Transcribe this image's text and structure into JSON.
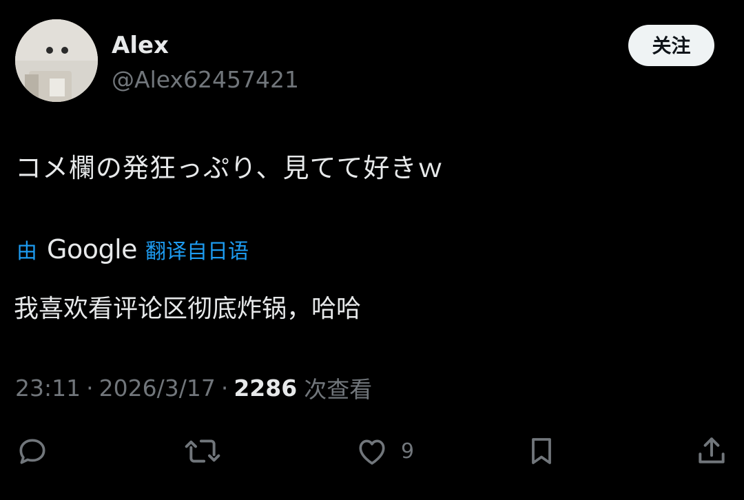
{
  "author": {
    "display_name": "Alex",
    "handle": "@Alex62457421",
    "avatar_icon": "avatar-photo"
  },
  "follow_button": {
    "label": "关注"
  },
  "tweet": {
    "text": "コメ欄の発狂っぷり、見てて好きｗ"
  },
  "translation": {
    "by_label": "由",
    "provider": "Google",
    "from_label": "翻译自日语",
    "text": "我喜欢看评论区彻底炸锅，哈哈"
  },
  "meta": {
    "time": "23:11",
    "date": "2026/3/17",
    "views_count": "2286",
    "views_label": "次查看"
  },
  "actions": {
    "reply_icon": "reply-icon",
    "retweet_icon": "retweet-icon",
    "like_icon": "heart-icon",
    "like_count": "9",
    "bookmark_icon": "bookmark-icon",
    "share_icon": "share-icon"
  },
  "colors": {
    "background": "#000000",
    "primary_text": "#e7e9ea",
    "secondary_text": "#71767b",
    "link_blue": "#1d9bf0",
    "button_bg": "#eff3f4"
  }
}
